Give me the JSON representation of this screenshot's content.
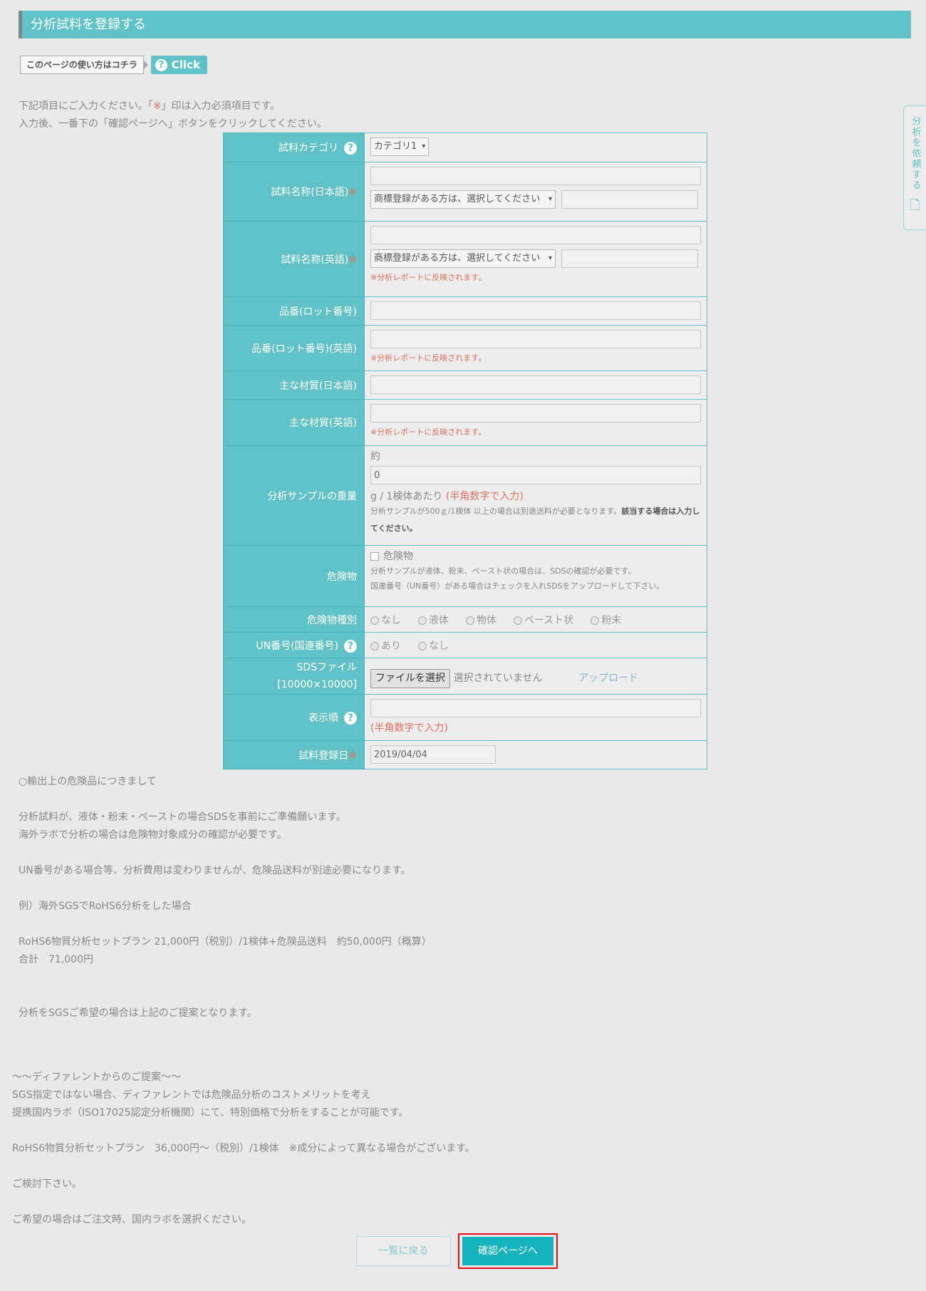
{
  "header": {
    "title": "分析試料を登録する"
  },
  "howto": {
    "label": "このページの使い方はコチラ",
    "button": "Click",
    "q": "?"
  },
  "intro": {
    "line1_pre": "下記項目にご入力ください。「",
    "line1_mark": "※",
    "line1_post": "」印は入力必須項目です。",
    "line2": "入力後、一番下の「確認ページへ」ボタンをクリックしてください。"
  },
  "side_tab": {
    "label": "分析を依頼する"
  },
  "form": {
    "req": "※",
    "q": "?",
    "category": {
      "label": "試料カテゴリ",
      "value": "カテゴリ1"
    },
    "name_ja": {
      "label": "試料名称(日本語)",
      "value": "",
      "tm_select": "商標登録がある方は、選択してください",
      "tm_value": ""
    },
    "name_en": {
      "label": "試料名称(英語)",
      "value": "",
      "tm_select": "商標登録がある方は、選択してください",
      "tm_value": "",
      "note": "※分析レポートに反映されます。"
    },
    "lot": {
      "label": "品番(ロット番号)",
      "value": ""
    },
    "lot_en": {
      "label": "品番(ロット番号)(英語)",
      "value": "",
      "note": "※分析レポートに反映されます。"
    },
    "material_ja": {
      "label": "主な材質(日本語)",
      "value": ""
    },
    "material_en": {
      "label": "主な材質(英語)",
      "value": "",
      "note": "※分析レポートに反映されます。"
    },
    "weight": {
      "label": "分析サンプルの重量",
      "prefix": "約",
      "value": "0",
      "unit": "g / 1検体あたり",
      "unit_note": "(半角数字で入力)",
      "note1": "分析サンプルが500ｇ/1検体 以上の場合は別途送料が必要となります。",
      "note2": "該当する場合は入力してください。"
    },
    "hazard": {
      "label": "危険物",
      "checkbox": "危険物",
      "note1": "分析サンプルが液体、粉末、ペースト状の場合は、SDSの確認が必要です。",
      "note2": "国連番号（UN番号）がある場合はチェックを入れSDSをアップロードして下さい。"
    },
    "hazard_type": {
      "label": "危険物種別",
      "options": [
        "なし",
        "液体",
        "物体",
        "ペースト状",
        "粉末"
      ]
    },
    "un_number": {
      "label": "UN番号(国連番号)",
      "options": [
        "あり",
        "なし"
      ]
    },
    "sds": {
      "label1": "SDSファイル",
      "label2": "[10000×10000]",
      "file_button": "ファイルを選択",
      "file_status": "選択されていません",
      "upload": "アップロード"
    },
    "order": {
      "label": "表示順",
      "value": "",
      "note": "(半角数字で入力)"
    },
    "reg_date": {
      "label": "試料登録日",
      "value": "2019/04/04"
    }
  },
  "notes": {
    "l1": "○輸出上の危険品につきまして",
    "l2": "分析試料が、液体・粉末・ペーストの場合SDSを事前にご準備願います。",
    "l3": "海外ラボで分析の場合は危険物対象成分の確認が必要です。",
    "l4": "UN番号がある場合等、分析費用は変わりませんが、危険品送料が別途必要になります。",
    "l5": "例）海外SGSでRoHS6分析をした場合",
    "l6": "RoHS6物質分析セットプラン 21,000円（税別）/1検体+危険品送料　約50,000円（概算）",
    "l7": "合計　71,000円",
    "l8": "分析をSGSご希望の場合は上記のご提案となります。"
  },
  "notes2": {
    "l1": "～～ディファレントからのご提案～～",
    "l2": "SGS指定ではない場合、ディファレントでは危険品分析のコストメリットを考え",
    "l3": "提携国内ラボ（ISO17025認定分析機関）にて、特別価格で分析をすることが可能です。",
    "l4": "RoHS6物質分析セットプラン　36,000円～（税別）/1検体　※成分によって異なる場合がございます。",
    "l5": "ご検討下さい。",
    "l6": "ご希望の場合はご注文時、国内ラボを選択ください。"
  },
  "buttons": {
    "back": "一覧に戻る",
    "confirm": "確認ページへ"
  }
}
